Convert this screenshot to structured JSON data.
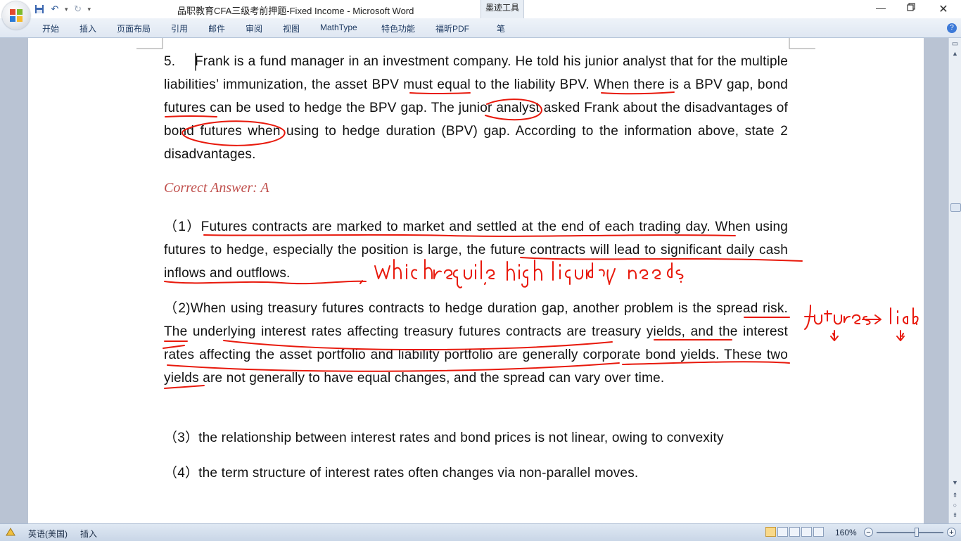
{
  "titlebar": {
    "title": "品职教育CFA三级考前押题-Fixed Income - Microsoft Word",
    "contextual_tab": "墨迹工具"
  },
  "ribbon": {
    "tabs": [
      "开始",
      "插入",
      "页面布局",
      "引用",
      "邮件",
      "审阅",
      "视图",
      "MathType",
      "特色功能",
      "福昕PDF",
      "笔"
    ]
  },
  "document": {
    "question_number": "5.",
    "question_text": "Frank is a fund manager in an investment company. He told his junior analyst that for the multiple liabilities’ immunization, the asset BPV must equal to the liability BPV. When there is a BPV gap, bond futures can be used to hedge the BPV gap. The junior analyst asked Frank about the disadvantages of bond futures when using to hedge duration (BPV) gap. According to the information above, state 2 disadvantages.",
    "correct_answer": "Correct Answer: A",
    "answers": [
      "（1）Futures contracts are marked to market and settled at the end of each trading day. When using futures to hedge, especially the position is large, the future contracts will lead to significant daily cash inflows and outflows.",
      "（2)When using treasury futures contracts to hedge duration gap, another problem is the spread risk. The underlying interest rates affecting treasury futures contracts are treasury yields, and the interest rates affecting the asset portfolio and liability portfolio are generally corporate bond yields. These two yields are not generally to have equal changes, and the spread can vary over time.",
      "（3）the relationship between interest rates and bond prices is not linear, owing to convexity",
      "（4）the term structure of interest rates often changes via non-parallel moves."
    ]
  },
  "status": {
    "language": "英语(美国)",
    "mode": "插入",
    "zoom": "160%",
    "zoom_fraction": 0.6
  },
  "colors": {
    "ink": "#e8190c",
    "answer_heading": "#c0504d"
  },
  "icons": [
    "office-logo-icon",
    "save-icon",
    "undo-icon",
    "redo-icon",
    "customize-qat-icon",
    "minimize-icon",
    "restore-icon",
    "close-icon",
    "help-icon",
    "scroll-up-icon",
    "scroll-down-icon",
    "prev-page-icon",
    "select-browse-icon",
    "next-page-icon"
  ]
}
